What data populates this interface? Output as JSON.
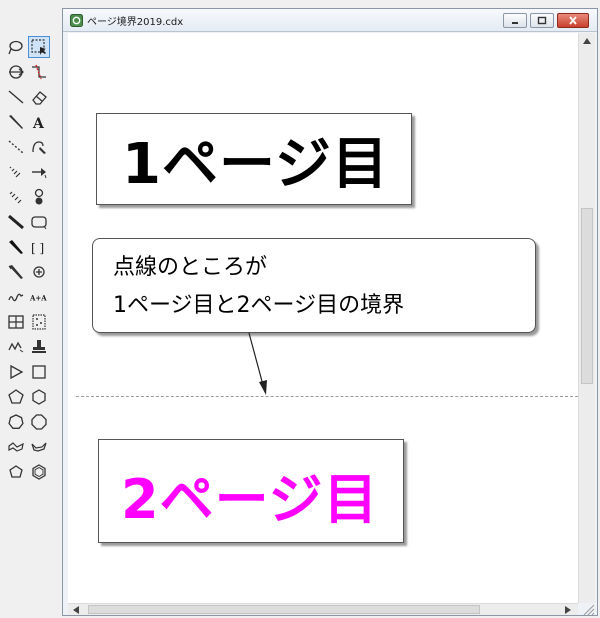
{
  "window": {
    "title": "ページ境界2019.cdx"
  },
  "document": {
    "page1_label": "1ページ目",
    "page2_label": "2ページ目",
    "callout_line1": "点線のところが",
    "callout_line2": "1ページ目と2ページ目の境界"
  },
  "toolbar": {
    "text_tool_glyph": "A",
    "text_tool2_glyph": "A+A",
    "bracket_tool_glyph": "[ ]"
  },
  "colors": {
    "page2_text": "#ff00ff",
    "page1_text": "#000000",
    "page_break_line": "#9a9a9a",
    "active_tool": "#cfe3f7"
  },
  "icons": [
    "lasso-icon",
    "marquee-select-icon",
    "structure-perspective-icon",
    "mass-fragmentation-icon",
    "solid-bond-icon",
    "eraser-icon",
    "wedge-bond-icon",
    "text-icon",
    "dashed-bond-icon",
    "pen-icon",
    "hashed-wedge-icon",
    "arrow-icon",
    "hashed-bond-icon",
    "orbital-icon",
    "bold-bond-icon",
    "rounded-rectangle-icon",
    "bold-wedge-icon",
    "bracket-icon",
    "wavy-wedge-icon",
    "charge-icon",
    "wavy-bond-icon",
    "text-tool2-icon",
    "table-icon",
    "tlc-plate-icon",
    "chain-icon",
    "stamp-icon",
    "triangle-icon",
    "square-icon",
    "pentagon-icon",
    "hexagon-icon",
    "heptagon-icon",
    "octagon-icon",
    "cyclohexane-chair-icon",
    "cyclohexane-boat-icon",
    "cyclopentane-icon",
    "benzene-icon"
  ]
}
